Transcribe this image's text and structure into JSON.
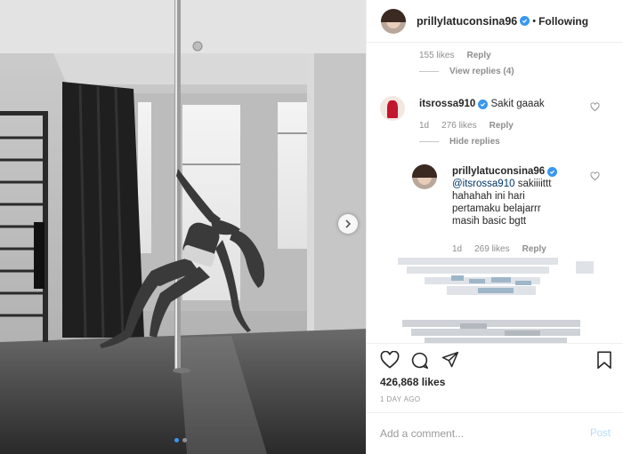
{
  "post": {
    "author": "prillylatuconsina96",
    "follow_status": "Following",
    "likes": "426,868 likes",
    "time_ago": "1 DAY AGO"
  },
  "comments": {
    "prev": {
      "likes": "155 likes",
      "reply": "Reply",
      "view_replies": "View replies (4)"
    },
    "rossa": {
      "username": "itsrossa910",
      "text": "Sakit gaaak",
      "time": "1d",
      "likes": "276 likes",
      "reply": "Reply",
      "hide_replies": "Hide replies"
    },
    "prilly_reply": {
      "username": "prillylatuconsina96",
      "mention": "@itsrossa910",
      "text": "sakiiiittt hahahah ini hari pertamaku belajarrr masih basic bgtt",
      "time": "1d",
      "likes": "269 likes",
      "reply": "Reply"
    }
  },
  "add_comment": {
    "placeholder": "Add a comment...",
    "post_label": "Post"
  },
  "carousel": {
    "total": 2,
    "active": 1
  },
  "icons": {
    "heart": "heart-icon",
    "comment": "comment-icon",
    "share": "share-icon",
    "save": "bookmark-icon",
    "next": "chevron-right-icon",
    "verified": "verified-badge-icon"
  },
  "colors": {
    "verified": "#3897f0",
    "post_disabled": "#b2dffc",
    "mention": "#003569",
    "muted": "#8e8e8e"
  }
}
